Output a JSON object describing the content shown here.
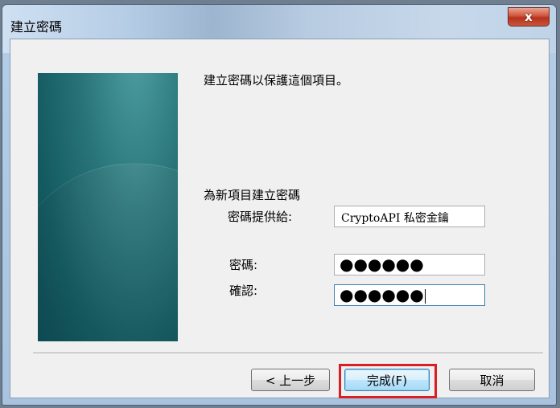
{
  "window": {
    "title": "建立密碼",
    "close_glyph": "x"
  },
  "main": {
    "heading": "建立密碼以保護這個項目。",
    "section_label": "為新項目建立密碼",
    "fields": {
      "provider_label": "密碼提供給:",
      "provider_value": "CryptoAPI 私密金鑰",
      "password_label": "密碼:",
      "password_value": "●●●●●●",
      "confirm_label": "確認:",
      "confirm_value": "●●●●●●"
    }
  },
  "buttons": {
    "back": "< 上一步",
    "finish": "完成(F)",
    "cancel": "取消"
  },
  "colors": {
    "highlight": "#d81f26",
    "side_panel": "#135a60"
  },
  "icons": {
    "close": "close-icon"
  }
}
